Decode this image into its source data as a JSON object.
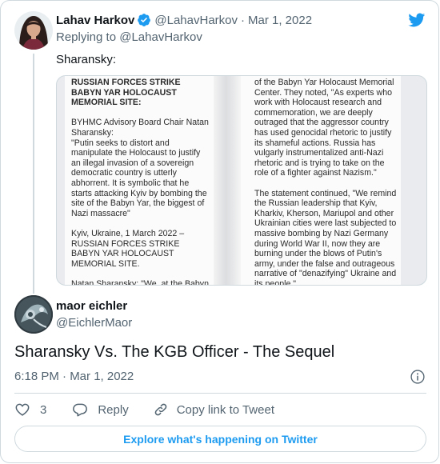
{
  "quoted_tweet": {
    "author_name": "Lahav Harkov",
    "handle": "@LahavHarkov",
    "separator": "·",
    "date": "Mar 1, 2022",
    "replying_prefix": "Replying to",
    "replying_handle": "@LahavHarkov",
    "text": "Sharansky:"
  },
  "media": {
    "left_page": {
      "headline": "RUSSIAN FORCES STRIKE BABYN YAR HOLOCAUST MEMORIAL SITE:",
      "p1": "BYHMC Advisory Board Chair Natan Sharansky:",
      "p2": "\"Putin seeks to distort and manipulate the Holocaust to justify an illegal invasion of a sovereign democratic country is utterly abhorrent. It is symbolic that he starts attacking Kyiv by bombing the site of the Babyn Yar, the biggest of Nazi massacre\"",
      "p3": "Kyiv, Ukraine, 1 March 2022 – RUSSIAN FORCES STRIKE BABYN YAR HOLOCAUST MEMORIAL SITE.",
      "p4": "Natan Sharansky: \"We, at the Babyn Yar Holocaust Memorial Center, built"
    },
    "right_page": {
      "p1": "of the Babyn Yar Holocaust Memorial Center. They noted, \"As experts who work with Holocaust research and commemoration, we are deeply outraged that the aggressor country has used genocidal rhetoric to justify its shameful actions. Russia has vulgarly instrumentalized anti-Nazi rhetoric and is trying to take on the role of a fighter against Nazism.\"",
      "p2": "The statement continued, \"We remind the Russian leadership that Kyiv, Kharkiv, Kherson, Mariupol and other Ukrainian cities were last subjected to massive bombing by Nazi Germany during World War II, now they are burning under the blows of Putin's army, under the false and outrageous narrative of \"denazifying\" Ukraine and its people.\""
    }
  },
  "main_tweet": {
    "author_name": "maor eichler",
    "handle": "@EichlerMaor",
    "text": "Sharansky Vs. The KGB Officer - The Sequel",
    "timestamp": "6:18 PM · Mar 1, 2022"
  },
  "actions": {
    "like_count": "3",
    "reply_label": "Reply",
    "copy_label": "Copy link to Tweet"
  },
  "explore_label": "Explore what's happening on Twitter",
  "icons": {
    "brand": "twitter-bird-icon",
    "verified": "verified-badge-icon",
    "info": "info-icon",
    "like": "heart-icon",
    "reply": "reply-bubble-icon",
    "copy": "link-icon"
  },
  "colors": {
    "accent": "#1d9bf0",
    "text": "#0f1419",
    "muted": "#536471",
    "border": "#cfd9de"
  }
}
